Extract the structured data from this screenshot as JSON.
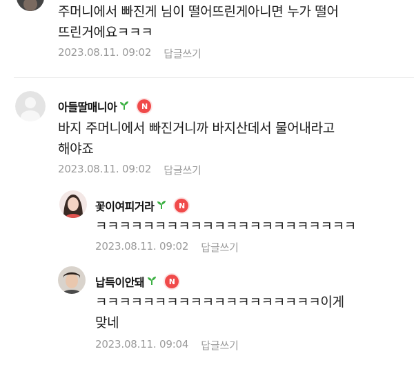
{
  "comments": [
    {
      "nick": "",
      "text_lines": [
        "주머니에서 빠진게 님이 떨어뜨린게아니면 누가 떨어",
        "뜨린거에요ㅋㅋㅋ"
      ],
      "timestamp": "2023.08.11. 09:02",
      "reply_label": "답글쓰기"
    },
    {
      "nick": "아들딸매니아",
      "badge": "N",
      "text_lines": [
        "바지 주머니에서 빠진거니까 바지산데서 물어내라고",
        "해야죠"
      ],
      "timestamp": "2023.08.11. 09:02",
      "reply_label": "답글쓰기"
    }
  ],
  "replies": [
    {
      "nick": "꽃이여피거라",
      "badge": "N",
      "text_lines": [
        "ㅋㅋㅋㅋㅋㅋㅋㅋㅋㅋㅋㅋㅋㅋㅋㅋㅋㅋㅋㅋㅋㅋ"
      ],
      "timestamp": "2023.08.11. 09:02",
      "reply_label": "답글쓰기"
    },
    {
      "nick": "납득이안돼",
      "badge": "N",
      "text_lines": [
        "ㅋㅋㅋㅋㅋㅋㅋㅋㅋㅋㅋㅋㅋㅋㅋㅋㅋㅋㅋ이게",
        "맞네"
      ],
      "timestamp": "2023.08.11. 09:04",
      "reply_label": "답글쓰기"
    }
  ],
  "colors": {
    "badge": "#f04a4a",
    "sprout": "#3cb043",
    "meta_text": "#9a9a9a"
  },
  "icons": {
    "grade_icon": "sprout-icon",
    "new_badge_icon": "n-badge-icon"
  }
}
